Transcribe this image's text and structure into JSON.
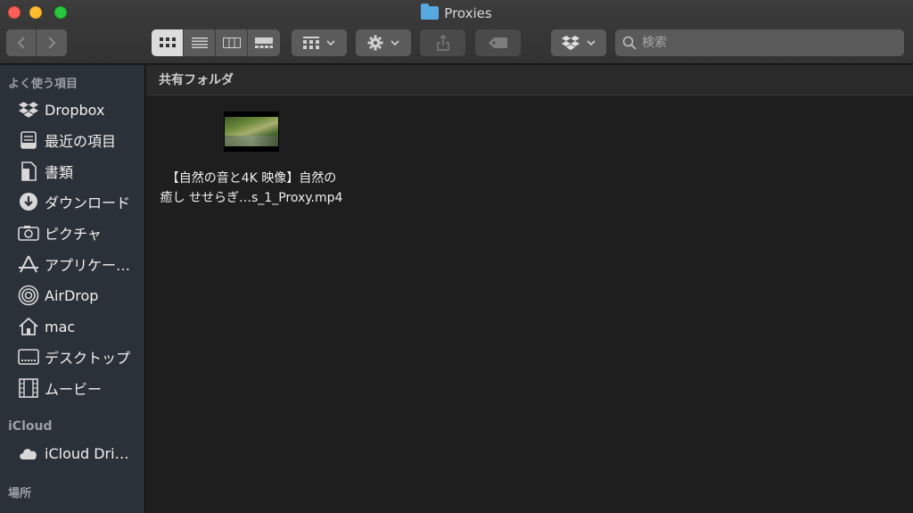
{
  "window": {
    "title": "Proxies"
  },
  "toolbar": {
    "icons": {
      "back": "chevron-left-icon",
      "forward": "chevron-right-icon",
      "view_icon": "grid-icon",
      "view_list": "list-icon",
      "view_column": "columns-icon",
      "view_gallery": "gallery-icon",
      "group": "group-grid-icon",
      "action": "gear-icon",
      "share": "share-icon",
      "tag": "tag-icon",
      "dropbox": "dropbox-icon"
    }
  },
  "search": {
    "placeholder": "検索"
  },
  "sidebar": {
    "favorites_heading": "よく使う項目",
    "favorites": [
      {
        "label": "Dropbox",
        "icon": "dropbox-icon"
      },
      {
        "label": "最近の項目",
        "icon": "recents-icon"
      },
      {
        "label": "書類",
        "icon": "documents-icon"
      },
      {
        "label": "ダウンロード",
        "icon": "download-icon"
      },
      {
        "label": "ピクチャ",
        "icon": "camera-icon"
      },
      {
        "label": "アプリケー…",
        "icon": "applications-icon"
      },
      {
        "label": "AirDrop",
        "icon": "airdrop-icon"
      },
      {
        "label": "mac",
        "icon": "home-icon"
      },
      {
        "label": "デスクトップ",
        "icon": "desktop-icon"
      },
      {
        "label": "ムービー",
        "icon": "movie-icon"
      }
    ],
    "icloud_heading": "iCloud",
    "icloud": [
      {
        "label": "iCloud Dri…",
        "icon": "cloud-icon"
      }
    ],
    "locations_heading": "場所"
  },
  "main": {
    "path_header": "共有フォルダ",
    "files": [
      {
        "name_line1": "【自然の音と4K 映像】自然の",
        "name_line2": "癒し せせらぎ…s_1_Proxy.mp4",
        "icon": "video-thumbnail-icon"
      }
    ]
  },
  "colors": {
    "sidebar_bg": "#2b3138",
    "main_bg": "#1e1e1e",
    "folder_accent": "#58a8e0"
  }
}
